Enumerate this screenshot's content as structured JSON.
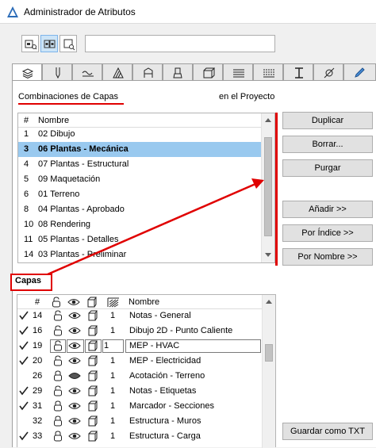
{
  "window": {
    "title": "Administrador de Atributos"
  },
  "toolbar": {
    "search_value": ""
  },
  "tabs": [
    {
      "icon": "layers-icon",
      "active": true
    },
    {
      "icon": "pen-icon"
    },
    {
      "icon": "line-type-icon"
    },
    {
      "icon": "fill-icon"
    },
    {
      "icon": "building-material-icon"
    },
    {
      "icon": "paint-bucket-icon"
    },
    {
      "icon": "composite-icon"
    },
    {
      "icon": "profile-icon"
    },
    {
      "icon": "zone-icon"
    },
    {
      "icon": "beam-icon"
    },
    {
      "icon": "pencil-icon"
    }
  ],
  "combinations": {
    "label": "Combinaciones de Capas",
    "scope_label": "en el Proyecto",
    "headers": [
      "#",
      "Nombre"
    ],
    "rows": [
      {
        "num": "1",
        "name": "02 Dibujo"
      },
      {
        "num": "3",
        "name": "06 Plantas - Mecánica",
        "selected": true
      },
      {
        "num": "4",
        "name": "07 Plantas - Estructural"
      },
      {
        "num": "5",
        "name": "09 Maquetación"
      },
      {
        "num": "6",
        "name": "01 Terreno"
      },
      {
        "num": "8",
        "name": "04 Plantas - Aprobado"
      },
      {
        "num": "10",
        "name": "08 Rendering"
      },
      {
        "num": "11",
        "name": "05 Plantas - Detalles"
      },
      {
        "num": "14",
        "name": "03 Plantas - Preliminar"
      }
    ]
  },
  "buttons": {
    "duplicar": "Duplicar",
    "borrar": "Borrar...",
    "purgar": "Purgar",
    "anadir": "Añadir >>",
    "por_indice": "Por Índice >>",
    "por_nombre": "Por Nombre >>",
    "guardar_txt": "Guardar como TXT"
  },
  "layers": {
    "label": "Capas",
    "headers": [
      "#",
      "Nombre"
    ],
    "rows": [
      {
        "checked": true,
        "num": "14",
        "lock": "unlocked",
        "visible": true,
        "wire": "1",
        "name": "Notas - General"
      },
      {
        "checked": true,
        "num": "16",
        "lock": "unlocked",
        "visible": true,
        "wire": "1",
        "name": "Dibujo 2D - Punto Caliente"
      },
      {
        "checked": true,
        "num": "19",
        "lock": "unlocked",
        "visible": true,
        "wire": "1",
        "name": "MEP - HVAC",
        "editing": true
      },
      {
        "checked": true,
        "num": "20",
        "lock": "unlocked",
        "visible": true,
        "wire": "1",
        "name": "MEP - Electricidad"
      },
      {
        "checked": false,
        "num": "26",
        "lock": "locked",
        "visible": false,
        "wire": "1",
        "name": "Acotación - Terreno"
      },
      {
        "checked": true,
        "num": "29",
        "lock": "unlocked",
        "visible": true,
        "wire": "1",
        "name": "Notas - Etiquetas"
      },
      {
        "checked": true,
        "num": "31",
        "lock": "locked",
        "visible": true,
        "wire": "1",
        "name": "Marcador - Secciones"
      },
      {
        "checked": false,
        "num": "32",
        "lock": "locked",
        "visible": true,
        "wire": "1",
        "name": "Estructura - Muros"
      },
      {
        "checked": true,
        "num": "33",
        "lock": "locked",
        "visible": true,
        "wire": "1",
        "name": "Estructura - Carga"
      }
    ]
  }
}
